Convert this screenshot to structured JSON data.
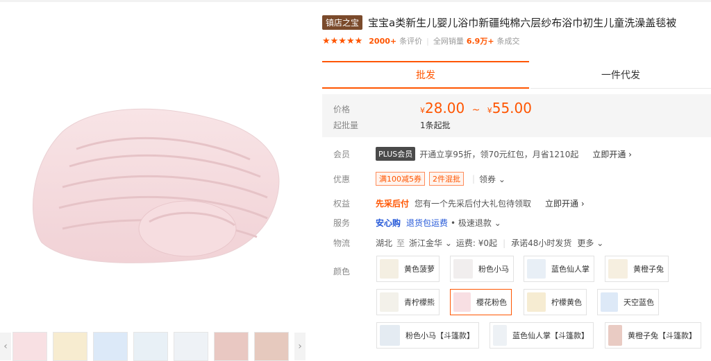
{
  "product": {
    "badge": "镇店之宝",
    "title": "宝宝a类新生儿婴儿浴巾新疆纯棉六层纱布浴巾初生儿童洗澡盖毯被",
    "stars": "★★★★★",
    "reviews_count": "2000+",
    "reviews_label": "条评价",
    "sales_label": "全网销量",
    "sales_count": "6.9万+",
    "sales_suffix": "条成交"
  },
  "tabs": {
    "wholesale": "批发",
    "dropship": "一件代发"
  },
  "price": {
    "label": "价格",
    "currency": "¥",
    "min": "28.00",
    "range_sep": "~",
    "max": "55.00",
    "moq_label": "起批量",
    "moq": "1条起批"
  },
  "member": {
    "label": "会员",
    "plus": "PLUS会员",
    "text": "开通立享95折，领70元红包，月省1210起",
    "action": "立即开通"
  },
  "promo": {
    "label": "优惠",
    "tag1": "满100减5券",
    "tag2": "2件混批",
    "coupon": "领券"
  },
  "rights": {
    "label": "权益",
    "name": "先采后付",
    "text": "您有一个先采后付大礼包待领取",
    "action": "立即开通"
  },
  "service": {
    "label": "服务",
    "name": "安心购",
    "link": "退货包运费",
    "extra": "• 极速退款"
  },
  "logistics": {
    "label": "物流",
    "from": "湖北",
    "to_word": "至",
    "to": "浙江金华",
    "fee": "运费: ¥0起",
    "promise": "承诺48小时发货",
    "more": "更多"
  },
  "color": {
    "label": "颜色",
    "options": [
      "黄色菠萝",
      "粉色小马",
      "蓝色仙人掌",
      "黄橙子兔",
      "青柠檬熊",
      "樱花粉色",
      "柠檬黄色",
      "天空蓝色",
      "粉色小马【斗篷款】",
      "蓝色仙人掌【斗篷款】",
      "黄橙子兔【斗篷款】"
    ],
    "selected": "樱花粉色"
  },
  "colors_theme": {
    "accent": "#ff5500",
    "badge": "#7a4a2b",
    "blue": "#2458d8"
  }
}
